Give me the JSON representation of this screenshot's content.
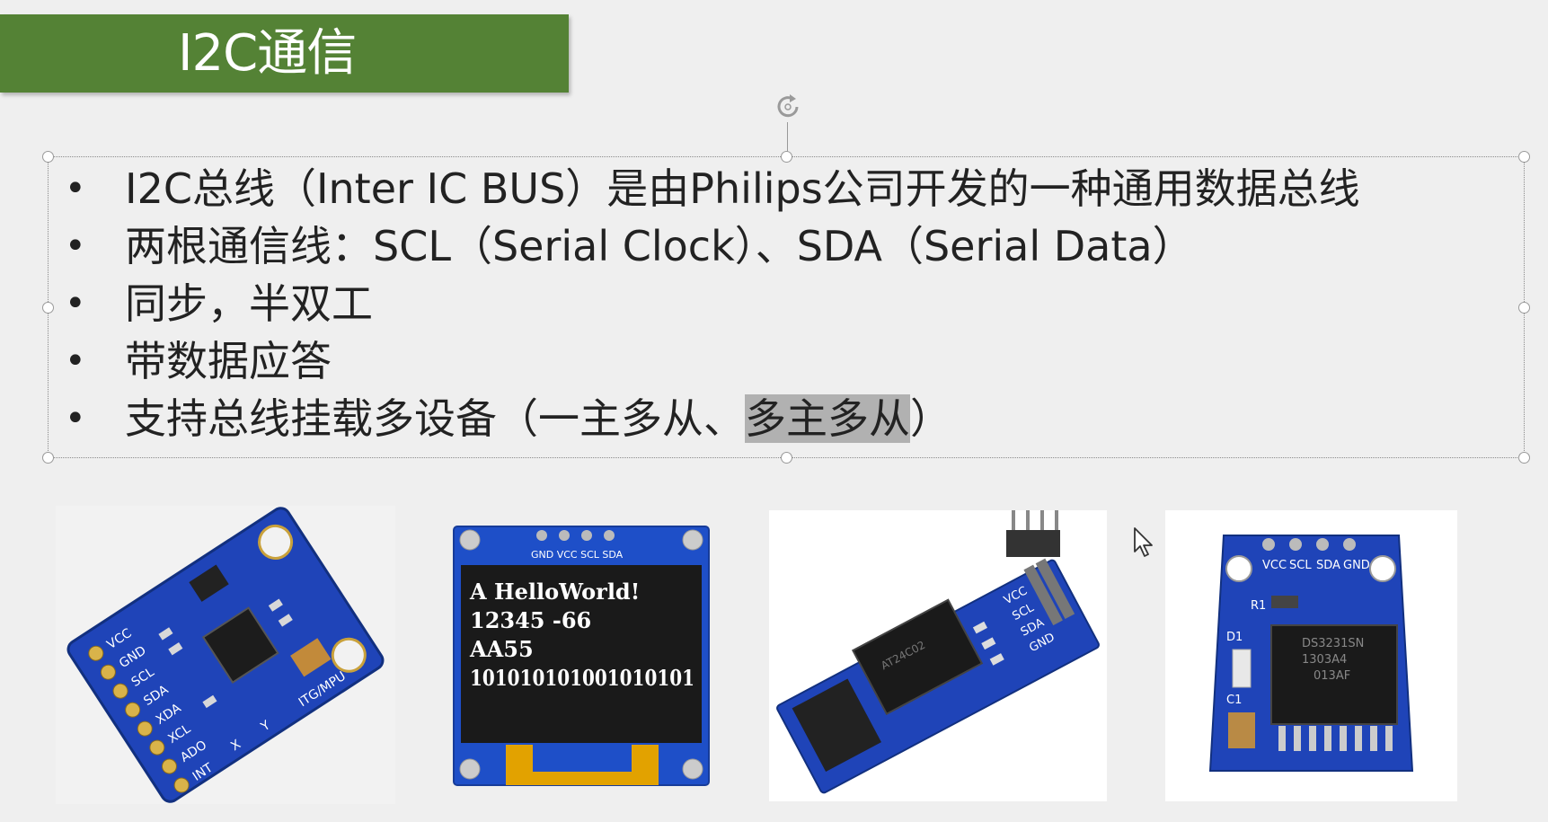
{
  "slide": {
    "title": "I2C通信",
    "bullets": [
      "I2C总线（Inter IC BUS）是由Philips公司开发的一种通用数据总线",
      "两根通信线：SCL（Serial Clock）、SDA（Serial Data）",
      "同步，半双工",
      "带数据应答"
    ],
    "bullet5": {
      "before": "支持总线挂载多设备（一主多从、",
      "highlight": "多主多从",
      "after": "）"
    }
  },
  "module_mpu": {
    "pins": [
      "VCC",
      "GND",
      "SCL",
      "SDA",
      "XDA",
      "XCL",
      "ADO",
      "INT"
    ],
    "label": "ITG/MPU",
    "axis_x": "X",
    "axis_y": "Y"
  },
  "module_oled": {
    "header_pins": "GND VCC SCL SDA",
    "lines": [
      "A HelloWorld!",
      "12345 -66",
      "AA55",
      "101010101001010101"
    ]
  },
  "module_eeprom": {
    "pins": [
      "VCC",
      "SCL",
      "SDA",
      "GND"
    ],
    "chip": "AT24C02"
  },
  "module_rtc": {
    "pins": [
      "VCC",
      "SCL",
      "SDA",
      "GND"
    ],
    "chip_lines": [
      "DS3231SN",
      "1303A4",
      "013AF"
    ],
    "labels": [
      "R1",
      "D1",
      "C1"
    ]
  },
  "colors": {
    "title_bar": "#548235",
    "pcb_blue": "#1f44b8",
    "highlight": "#b1b1b1"
  }
}
